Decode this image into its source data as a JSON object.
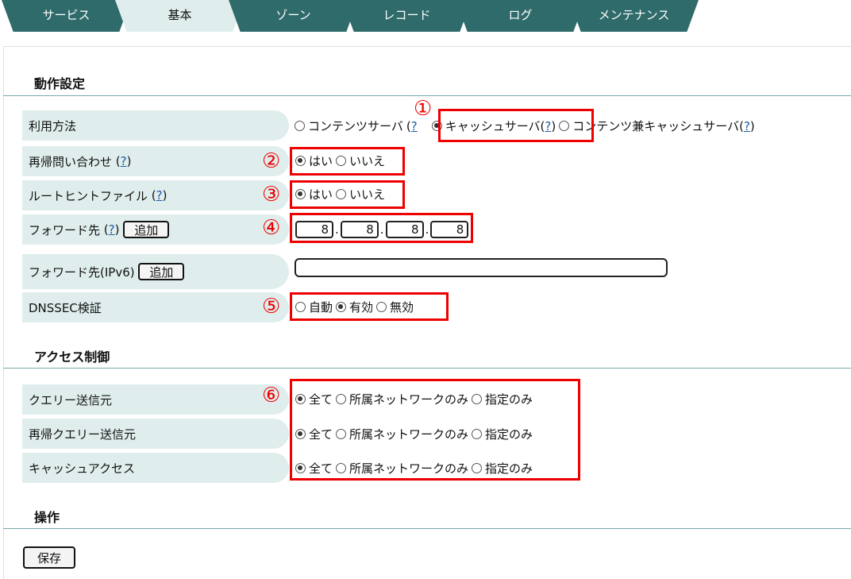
{
  "tabs": [
    "サービス",
    "基本",
    "ゾーン",
    "レコード",
    "ログ",
    "メンテナンス"
  ],
  "active_tab": "基本",
  "sections": {
    "operation_settings": "動作設定",
    "access_control": "アクセス制御",
    "operation": "操作"
  },
  "help": "?",
  "rows": {
    "usage": {
      "label": "利用方法",
      "options": [
        "コンテンツサーバ",
        "キャッシュサーバ",
        "コンテンツ兼キャッシュサーバ"
      ],
      "selected": "キャッシュサーバ"
    },
    "recursive": {
      "label": "再帰問い合わせ",
      "options": [
        "はい",
        "いいえ"
      ],
      "selected": "はい"
    },
    "root_hint": {
      "label": "ルートヒントファイル",
      "options": [
        "はい",
        "いいえ"
      ],
      "selected": "はい"
    },
    "forward": {
      "label": "フォワード先",
      "add_button": "追加",
      "ip": [
        "8",
        "8",
        "8",
        "8"
      ]
    },
    "forward_ipv6": {
      "label": "フォワード先(IPv6)",
      "add_button": "追加",
      "value": ""
    },
    "dnssec": {
      "label": "DNSSEC検証",
      "options": [
        "自動",
        "有効",
        "無効"
      ],
      "selected": "有効"
    },
    "query_source": {
      "label": "クエリー送信元",
      "options": [
        "全て",
        "所属ネットワークのみ",
        "指定のみ"
      ],
      "selected": "全て"
    },
    "recursive_query_source": {
      "label": "再帰クエリー送信元",
      "options": [
        "全て",
        "所属ネットワークのみ",
        "指定のみ"
      ],
      "selected": "全て"
    },
    "cache_access": {
      "label": "キャッシュアクセス",
      "options": [
        "全て",
        "所属ネットワークのみ",
        "指定のみ"
      ],
      "selected": "全て"
    }
  },
  "save_button": "保存",
  "annotations": [
    "①",
    "②",
    "③",
    "④",
    "⑤",
    "⑥"
  ],
  "colors": {
    "tab": "#2f6b6a",
    "tab_active": "#dfeeed",
    "label_bg": "#dfeeed",
    "highlight": "#e00000",
    "link": "#1d5aa8"
  }
}
